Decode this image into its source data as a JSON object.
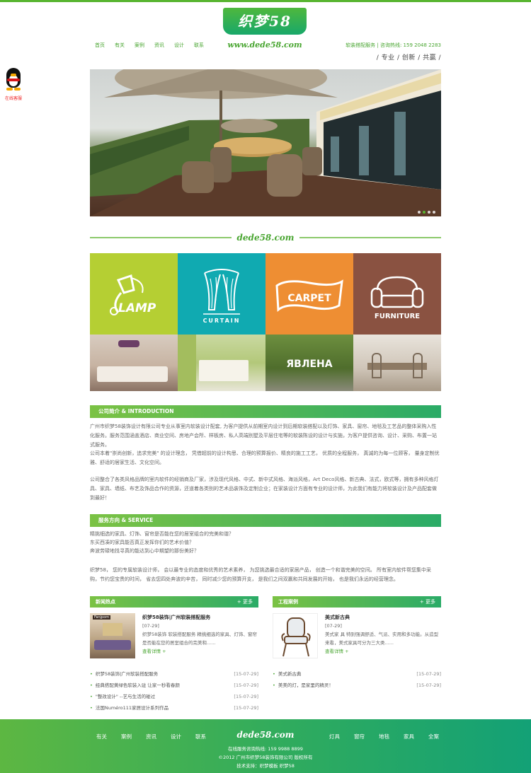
{
  "header": {
    "logo_text": "织梦58",
    "logo_url": "www.dede58.com",
    "nav": [
      "首页",
      "有关",
      "案例",
      "资讯",
      "设计",
      "联系"
    ],
    "hotline": "软装搭配服务 | 咨询热线: 159 2048 2283",
    "slogan": "/ 专业 / 创新 / 共赢 /"
  },
  "qq": {
    "label": "在线客服"
  },
  "banner": {
    "dot_count": 4,
    "active_dot": 1
  },
  "divider": {
    "text": "dede58.com"
  },
  "tiles": [
    {
      "caption": "LAMP",
      "color": "#b5cf33"
    },
    {
      "caption": "CURTAIN",
      "color": "#10aab1"
    },
    {
      "caption": "CARPET",
      "color": "#ee8e33"
    },
    {
      "caption": "FURNITURE",
      "color": "#8a5241"
    }
  ],
  "photo_overlay_text": "ЯВЛЕНА",
  "intro": {
    "heading": "公司简介 & INTRODUCTION",
    "paragraphs": [
      "广州市织梦58装饰设计有限公司专业从事室内软装设计配套, 为客户提供从前期室内设计到后期软装搭配以及灯饰、家具、窗帘、地毯及工艺品的整体采购入性化服务。服务范围涵盖酒店、商业空间、房地产会所、样板房、私人高端别墅及平层住宅等的软装陈设的设计与实施，为客户提供咨询、设计、采购、布置一站式服务。",
      "公司本着\"崇尚创新，追求完美\" 的设计理念， 凭借超前的设计构思、合理的预算报价、精良的施工工艺， 优质的全程服务， 真诚的为每一位顾客， 量身定制优雅、舒适的居家生活、文化空间。",
      "公司整合了各类风格品牌的室内软件的经销商及厂家，涉及现代风格、中式、新中式风格、海派风格，Art Deco风格、新古典、法式，欧式等，拥有多种风格灯具、家具、墙纸、布艺及饰品合作的资源，还道着各类别的艺术品装饰及定制企业；在家装设计方面有专业的设计师，为此我们有能力将软装设计及产品配套做到最好！"
    ]
  },
  "service": {
    "heading": "服务方向 & SERVICE",
    "questions": [
      "精挑细选的家具、灯饰、窗帘是否能在您的居室组合的完美和谐？",
      "东买西凑的家具能否真正发挥你们的艺术价值？",
      "奔波劳碌地找寻真的能达到心中期望的那份美好？"
    ],
    "paragraph": "织梦58， 您的专属软装设计师， 会以最专业的态度和优秀的艺术素养， 为您挑选最合适的家居产品， 创造一个和谐完美的空间。 所有室内软件帮您集中采购，节约您宝贵的时间， 省去您四处奔波的辛苦， 同时减少您的预算开支， 是我们之间双赢和共同发展的开始， 也是我们永远的经营理念。"
  },
  "news": {
    "heading": "新闻热点",
    "more": "+ 更多",
    "featured": {
      "title": "织梦58装饰|广州软装搭配服务",
      "date": "[07-29]",
      "summary": "织梦58装饰 软装搭配服务 精挑细选的家具、灯饰、窗帘是否能在您的居室组合的完美和......",
      "detail": "查看详情 +",
      "image_label": "Fanjpom"
    },
    "items": [
      {
        "title": "织梦58装饰|广州软装搭配服务",
        "date": "[15-07-29]"
      },
      {
        "title": "经典搭配黄绿色软装入驻 让家一秒看春颜",
        "date": "[15-07-29]"
      },
      {
        "title": "\"整改设计\" --艺与生活的碰过",
        "date": "[15-07-29]"
      },
      {
        "title": "法国Numéro111家居设计系列作品",
        "date": "[15-07-29]"
      }
    ]
  },
  "cases": {
    "heading": "工程案例",
    "more": "+ 更多",
    "featured": {
      "title": "美式新古典",
      "date": "[07-29]",
      "summary": "美式家 具 特别强调舒适、气派、实用和多功能。从造型来看，美式家具可分为三大类......",
      "detail": "查看详情 +"
    },
    "items": [
      {
        "title": "美式新古典",
        "date": "[15-07-29]"
      },
      {
        "title": "美美的灯，是家里的精灵！",
        "date": "[15-07-29]"
      }
    ]
  },
  "footer": {
    "nav_left": [
      "有关",
      "案例",
      "资讯",
      "设计",
      "联系"
    ],
    "logo_text": "dede58.com",
    "nav_right": [
      "灯具",
      "窗帘",
      "地毯",
      "家具",
      "全案"
    ],
    "hotline": "在线服务咨询热线: 159 9988 8899",
    "copyright": "©2012 广州市织梦58装饰有限公司 版权所有",
    "support": "技术支持：织梦模板 织梦58"
  },
  "colors": {
    "brand_green": "#4aa632",
    "gradient_start": "#7bc244",
    "gradient_end": "#2aab67"
  }
}
